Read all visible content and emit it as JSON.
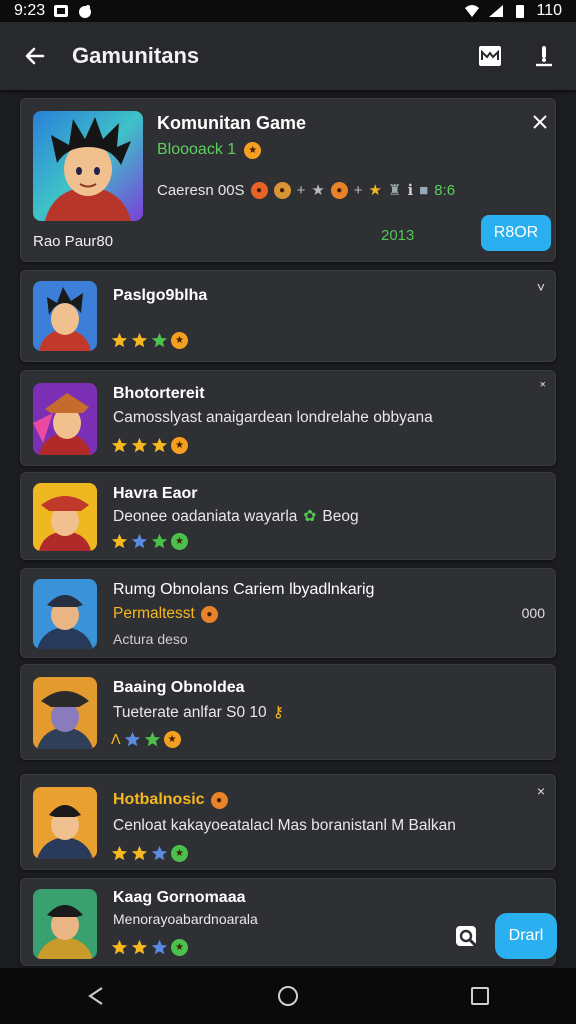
{
  "status_bar": {
    "time": "9:23",
    "battery_text": "110"
  },
  "app_bar": {
    "title": "Gamunitans"
  },
  "featured": {
    "title": "Komunitan Game",
    "subtitle": "Bloooack 1",
    "meta": "Caeresn 00S",
    "meta_end": "8:6",
    "footer": "Rao Paur80",
    "year": "2013",
    "button": "R8OR"
  },
  "items": [
    {
      "title": "Paslgo9blha",
      "desc": "",
      "extra": "",
      "corner": "˅"
    },
    {
      "title": "Bhotortereit",
      "desc": "Camosslyast anaigardean londrelahe obbyana",
      "extra": "",
      "corner": "˟"
    },
    {
      "title": "Havra Eaor",
      "desc": "Deonee oadaniata wayarla",
      "desc_tail": "Beog",
      "extra": "",
      "corner": ""
    },
    {
      "title": "Rumg Obnolans Cariem lbyadlnkarig",
      "desc": "Permaltesst",
      "extra": "Actura deso",
      "corner": "000",
      "accent": true
    },
    {
      "title": "Baaing Obnoldea",
      "desc": "Tueterate anlfar S0 10",
      "extra": "",
      "corner": ""
    },
    {
      "title": "Hotbalnosic",
      "desc": "Cenloat kakayoeatalacl Mas boranistanl M Balkan",
      "extra": "",
      "corner": "×",
      "accent": true
    },
    {
      "title": "Kaag Gornomaaa",
      "desc": "Menorayoabardnoarala",
      "extra": "",
      "corner": "",
      "fab": "Drarl"
    }
  ],
  "colors": {
    "accent_blue": "#2ab0f0",
    "green": "#54c554",
    "gold": "#f5b820",
    "card": "#2e3034",
    "bg": "#1c1d20"
  }
}
